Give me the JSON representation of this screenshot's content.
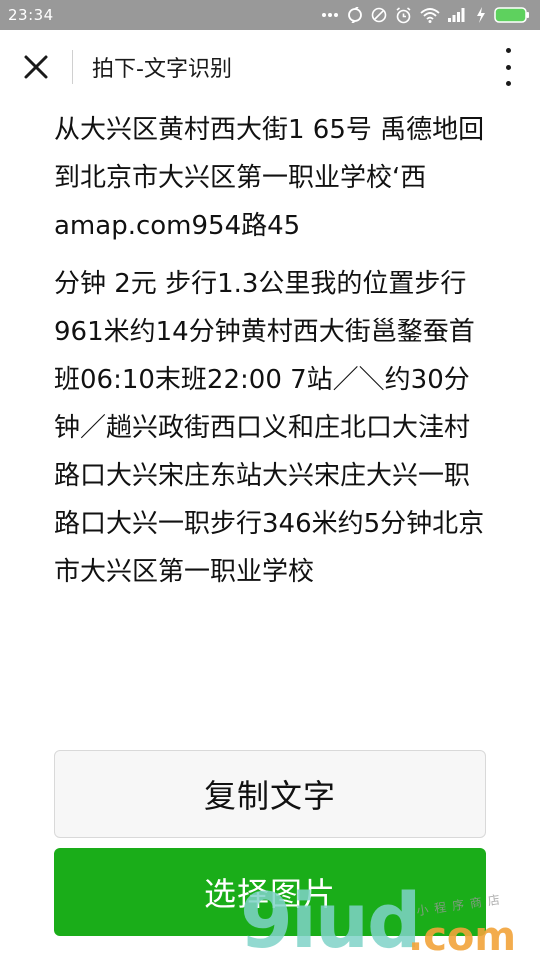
{
  "status_bar": {
    "time": "23:34"
  },
  "header": {
    "title": "拍下-文字识别"
  },
  "content": {
    "paragraph1": "从大兴区黄村西大街1 65号 禹德地回到北京市大兴区第一职业学校‘西amap.com954路45",
    "paragraph2": "分钟 2元 步行1.3公里我的位置步行961米约14分钟黄村西大街邕鍪蚕首班06:10末班22:00 7站／＼约30分钟／趟兴政街西口义和庄北口大洼村路口大兴宋庄东站大兴宋庄大兴一职路口大兴一职步行346米约5分钟北京市大兴区第一职业学校"
  },
  "buttons": {
    "copy_label": "复制文字",
    "select_label": "选择图片"
  },
  "watermark": {
    "main": "9iud",
    "suffix": ".com",
    "small": "小程序商店"
  },
  "colors": {
    "status_bar": "#999999",
    "primary_green": "#1aad19",
    "copy_button_bg": "#f7f7f7"
  }
}
